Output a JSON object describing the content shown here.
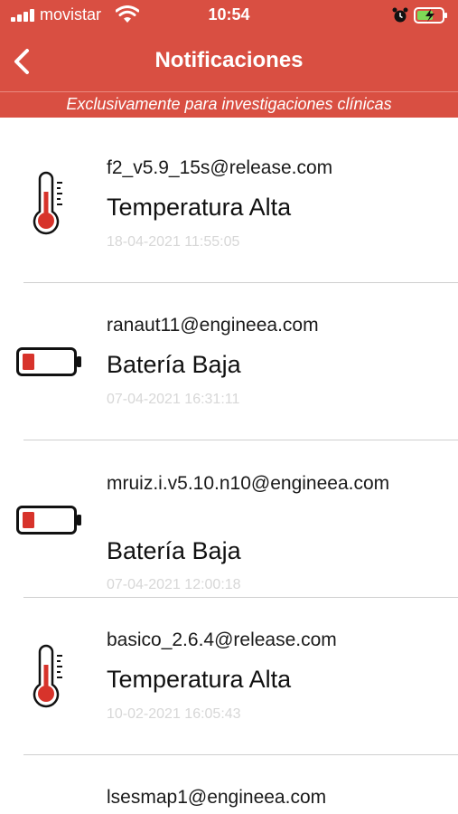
{
  "status_bar": {
    "carrier": "movistar",
    "time": "10:54",
    "icons": [
      "signal-icon",
      "wifi-icon",
      "alarm-icon",
      "battery-charging-icon"
    ]
  },
  "header": {
    "title": "Notificaciones",
    "back_icon": "chevron-left-icon",
    "subtitle": "Exclusivamente para investigaciones clínicas"
  },
  "colors": {
    "brand": "#d94f42",
    "alert_icon": "#d7332b",
    "timestamp": "#d7d7d7"
  },
  "notifications": [
    {
      "email": "f2_v5.9_15s@release.com",
      "type": "Temperatura Alta",
      "time": "18-04-2021 11:55:05",
      "icon": "thermometer-icon"
    },
    {
      "email": "ranaut11@engineea.com",
      "type": "Batería Baja",
      "time": "07-04-2021 16:31:11",
      "icon": "battery-low-icon"
    },
    {
      "email": "mruiz.i.v5.10.n10@engineea.com",
      "type": "Batería Baja",
      "time": "07-04-2021 12:00:18",
      "icon": "battery-low-icon"
    },
    {
      "email": "basico_2.6.4@release.com",
      "type": "Temperatura Alta",
      "time": "10-02-2021 16:05:43",
      "icon": "thermometer-icon"
    },
    {
      "email": "lsesmap1@engineea.com"
    }
  ]
}
